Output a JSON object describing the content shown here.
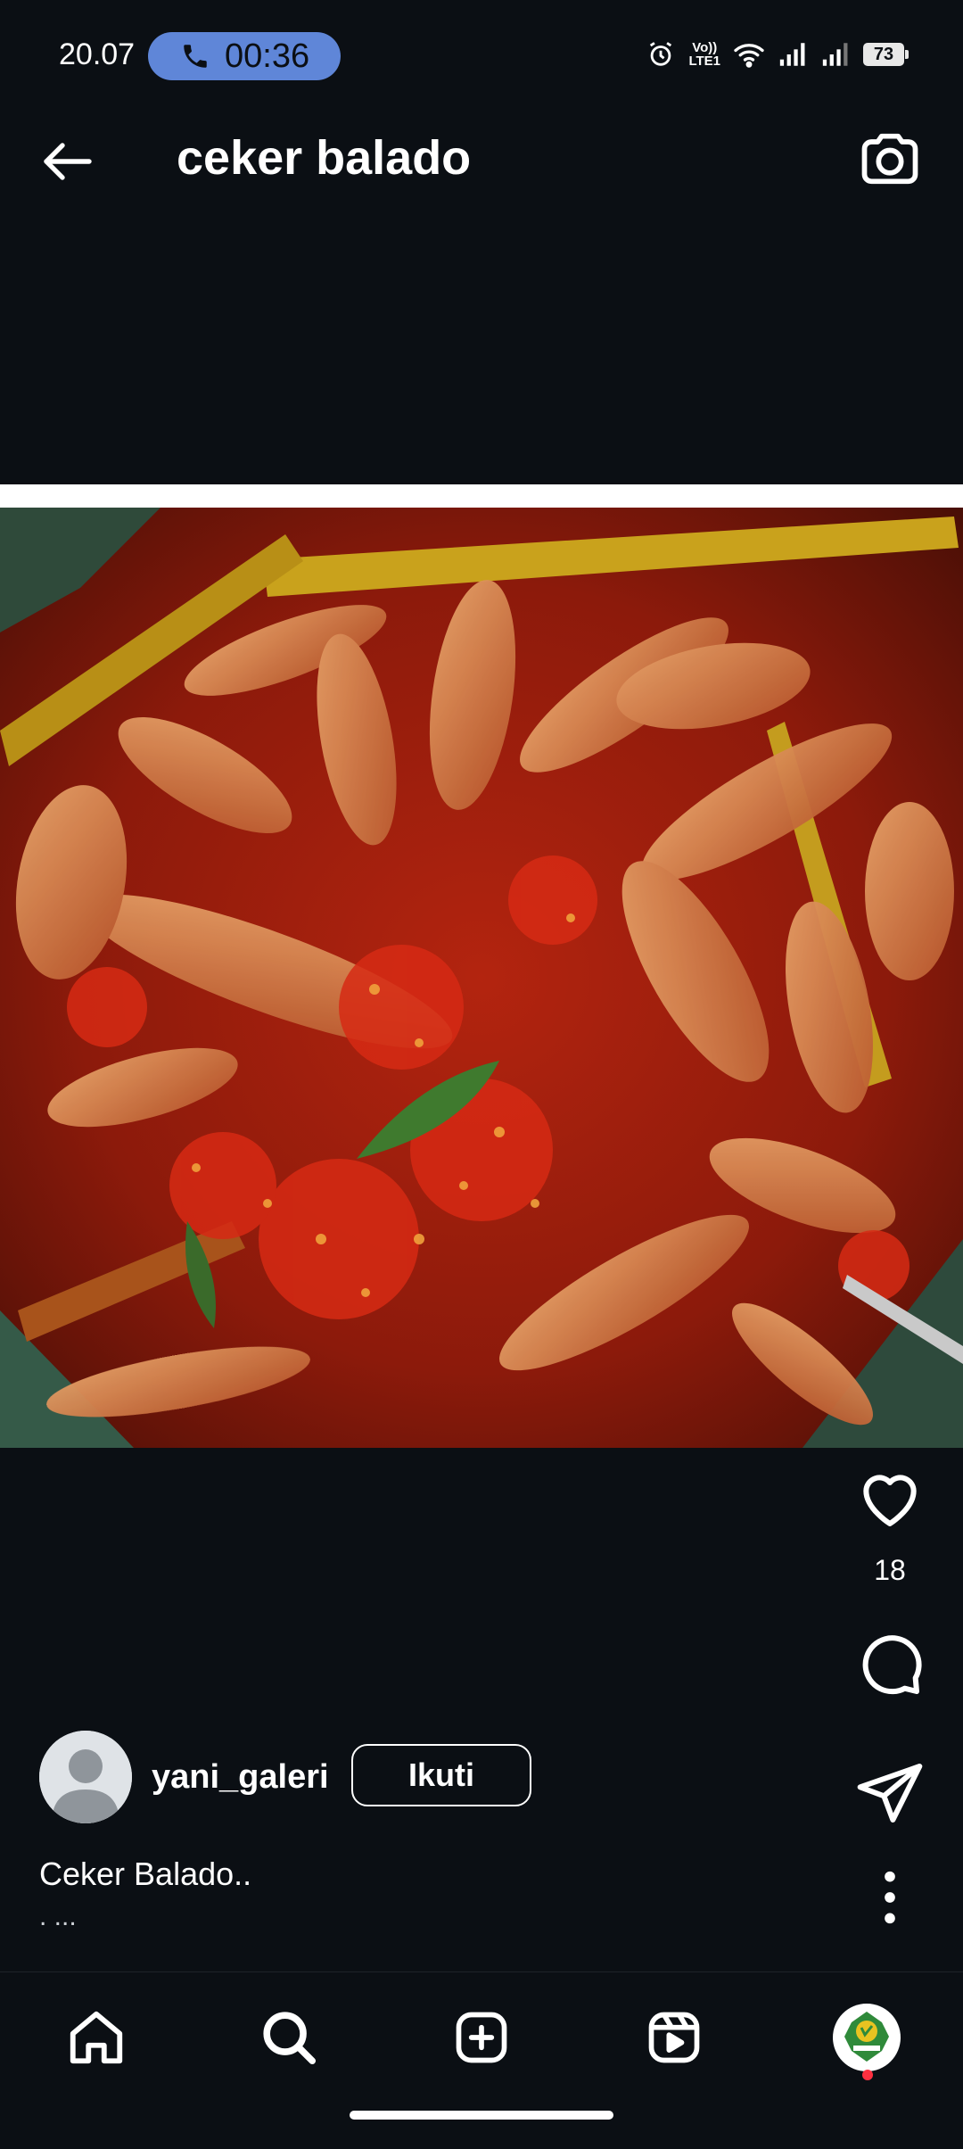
{
  "status_bar": {
    "time": "20.07",
    "call_timer": "00:36",
    "network_label_top": "Vo))",
    "network_label_bottom": "LTE1",
    "battery": "73",
    "icons": [
      "alarm-icon",
      "wifi-icon",
      "signal-icon",
      "signal-icon-2",
      "battery-icon"
    ]
  },
  "header": {
    "title": "ceker balado",
    "back_icon": "arrow-left-icon",
    "camera_icon": "camera-icon"
  },
  "post": {
    "image_subject": "ceker balado",
    "likes": "18",
    "author": {
      "username": "yani_galeri",
      "follow_label": "Ikuti"
    },
    "caption": "Ceker Balado..",
    "caption_more": ". ..."
  },
  "bottom_nav": {
    "items": [
      "home-icon",
      "search-icon",
      "create-icon",
      "reels-icon",
      "profile-avatar"
    ]
  },
  "colors": {
    "background": "#0b0f14",
    "call_pill": "#5f86d8",
    "notification_dot": "#ff3040"
  }
}
